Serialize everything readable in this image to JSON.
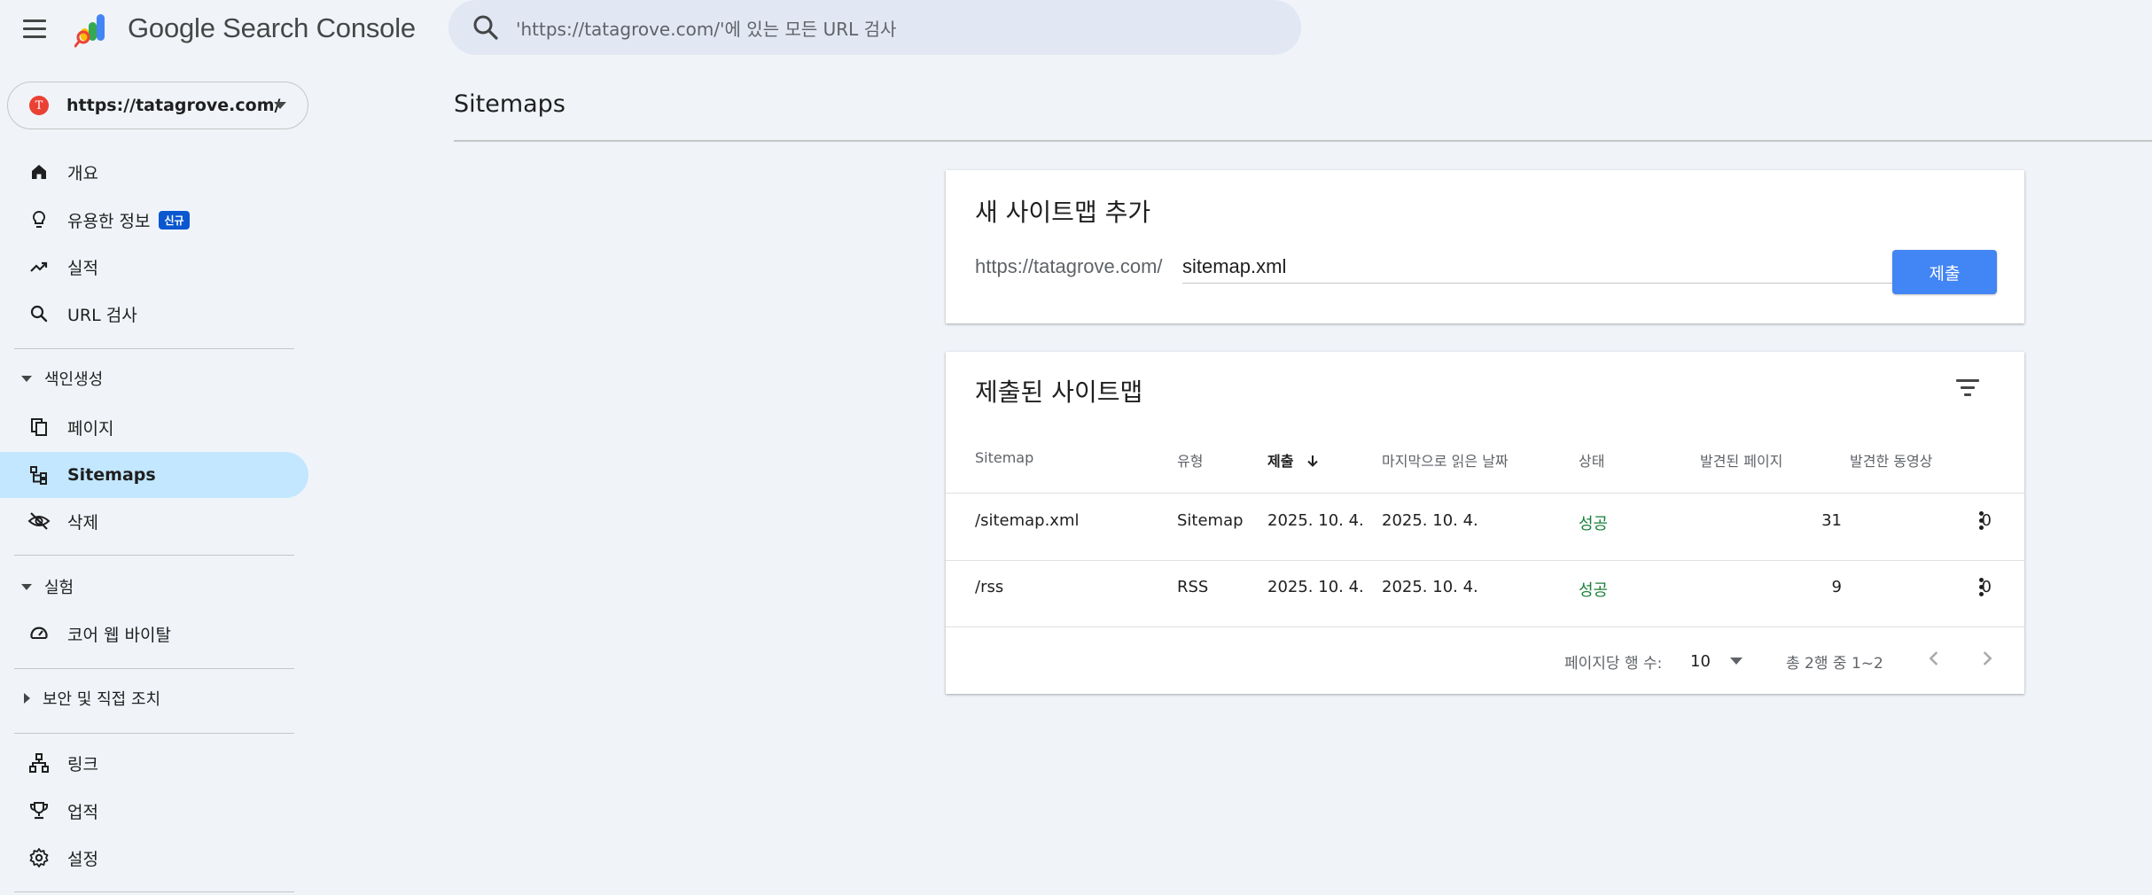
{
  "app": {
    "brand": "Google Search Console",
    "search_placeholder": "'https://tatagrove.com/'에 있는 모든 URL 검사"
  },
  "property": {
    "favicon_letter": "T",
    "url": "https://tatagrove.com/"
  },
  "sidebar": {
    "items": [
      {
        "label": "개요",
        "icon": "home-icon"
      },
      {
        "label": "유용한 정보",
        "icon": "lightbulb-icon",
        "badge": "신규"
      },
      {
        "label": "실적",
        "icon": "trending-up-icon"
      },
      {
        "label": "URL 검사",
        "icon": "search-icon"
      },
      {
        "label": "페이지",
        "icon": "pages-icon"
      },
      {
        "label": "Sitemaps",
        "icon": "sitemap-icon",
        "active": true
      },
      {
        "label": "삭제",
        "icon": "visibility-off-icon"
      },
      {
        "label": "코어 웹 바이탈",
        "icon": "speed-icon"
      },
      {
        "label": "링크",
        "icon": "links-icon"
      },
      {
        "label": "업적",
        "icon": "trophy-icon"
      },
      {
        "label": "설정",
        "icon": "gear-icon"
      }
    ],
    "sections": [
      {
        "label": "색인생성",
        "expanded": true
      },
      {
        "label": "실험",
        "expanded": true
      },
      {
        "label": "보안 및 직접 조치",
        "expanded": false
      }
    ]
  },
  "main": {
    "page_title": "Sitemaps",
    "add_card": {
      "title": "새 사이트맵 추가",
      "prefix": "https://tatagrove.com/",
      "input_value": "sitemap.xml",
      "submit_label": "제출"
    },
    "list_card": {
      "title": "제출된 사이트맵",
      "columns": [
        "Sitemap",
        "유형",
        "제출",
        "마지막으로 읽은 날짜",
        "상태",
        "발견된 페이지",
        "발견한 동영상"
      ],
      "sorted_column": "제출",
      "rows": [
        {
          "sitemap": "/sitemap.xml",
          "type": "Sitemap",
          "submitted": "2025. 10. 4.",
          "last_read": "2025. 10. 4.",
          "status": "성공",
          "pages": "31",
          "videos": "0"
        },
        {
          "sitemap": "/rss",
          "type": "RSS",
          "submitted": "2025. 10. 4.",
          "last_read": "2025. 10. 4.",
          "status": "성공",
          "pages": "9",
          "videos": "0"
        }
      ],
      "footer": {
        "rows_per_page_label": "페이지당 행 수:",
        "rows_per_page": "10",
        "range": "총 2행 중 1~2"
      }
    }
  },
  "colors": {
    "background": "#f0f4f9",
    "active_nav": "#c2e7ff",
    "primary_button": "#4285f4",
    "success": "#188038",
    "badge": "#0b57d0"
  }
}
